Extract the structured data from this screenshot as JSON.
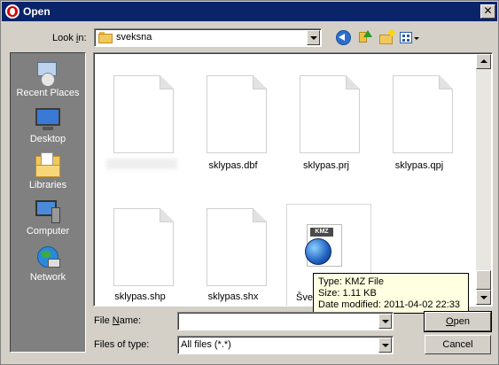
{
  "window": {
    "title": "Open",
    "close_glyph": "✕"
  },
  "toolbar": {
    "look_in_prefix": "Look ",
    "look_in_accel": "i",
    "look_in_suffix": "n:",
    "look_in_value": "sveksna"
  },
  "places": [
    {
      "label": "Recent Places",
      "icon": "recent-places-icon"
    },
    {
      "label": "Desktop",
      "icon": "desktop-icon"
    },
    {
      "label": "Libraries",
      "icon": "libraries-icon"
    },
    {
      "label": "Computer",
      "icon": "computer-icon"
    },
    {
      "label": "Network",
      "icon": "network-icon"
    }
  ],
  "files": [
    {
      "name": ""
    },
    {
      "name": "sklypas.dbf"
    },
    {
      "name": "sklypas.prj"
    },
    {
      "name": "sklypas.qpj"
    },
    {
      "name": "sklypas.shp"
    },
    {
      "name": "sklypas.shx"
    },
    {
      "name": "Šve",
      "badge": "KMZ"
    }
  ],
  "tooltip": {
    "type": "Type: KMZ File",
    "size": "Size: 1.11 KB",
    "date": "Date modified: 2011-04-02 22:33"
  },
  "form": {
    "file_name_accel": "N",
    "file_name_prefix": "File ",
    "file_name_suffix": "ame:",
    "file_name_value": "",
    "files_of_type_label": "Files of type:",
    "files_of_type_value": "All files (*.*)"
  },
  "buttons": {
    "open_accel": "O",
    "open_rest": "pen",
    "cancel": "Cancel"
  }
}
